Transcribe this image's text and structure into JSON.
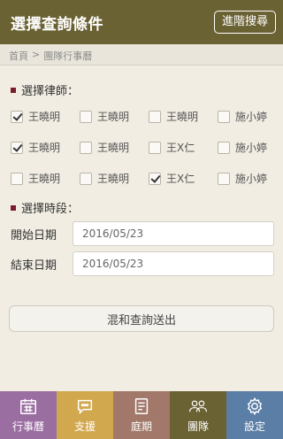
{
  "header": {
    "title": "選擇查詢條件",
    "advanced_label": "進階搜尋"
  },
  "breadcrumb": {
    "home": "首頁",
    "sep": ">",
    "current": "團隊行事曆"
  },
  "lawyers_section": {
    "title": "選擇律師："
  },
  "lawyers": [
    [
      {
        "name": "王曉明",
        "checked": true
      },
      {
        "name": "王曉明",
        "checked": false
      },
      {
        "name": "王曉明",
        "checked": false
      },
      {
        "name": "施小婷",
        "checked": false
      }
    ],
    [
      {
        "name": "王曉明",
        "checked": true
      },
      {
        "name": "王曉明",
        "checked": false
      },
      {
        "name": "王X仁",
        "checked": false
      },
      {
        "name": "施小婷",
        "checked": false
      }
    ],
    [
      {
        "name": "王曉明",
        "checked": false
      },
      {
        "name": "王曉明",
        "checked": false
      },
      {
        "name": "王X仁",
        "checked": true
      },
      {
        "name": "施小婷",
        "checked": false
      }
    ]
  ],
  "period_section": {
    "title": "選擇時段："
  },
  "start": {
    "label": "開始日期",
    "value": "2016/05/23"
  },
  "end": {
    "label": "結束日期",
    "value": "2016/05/23"
  },
  "search_button": "混和查詢送出",
  "tabs": [
    {
      "label": "行事曆",
      "icon": "calendar-icon",
      "color": "#9a6ea0"
    },
    {
      "label": "支援",
      "icon": "chat-bubble-icon",
      "color": "#d2a84e"
    },
    {
      "label": "庭期",
      "icon": "document-icon",
      "color": "#a1786a"
    },
    {
      "label": "團隊",
      "icon": "team-icon",
      "color": "#6b6234"
    },
    {
      "label": "設定",
      "icon": "gear-icon",
      "color": "#5b7ea6"
    }
  ]
}
